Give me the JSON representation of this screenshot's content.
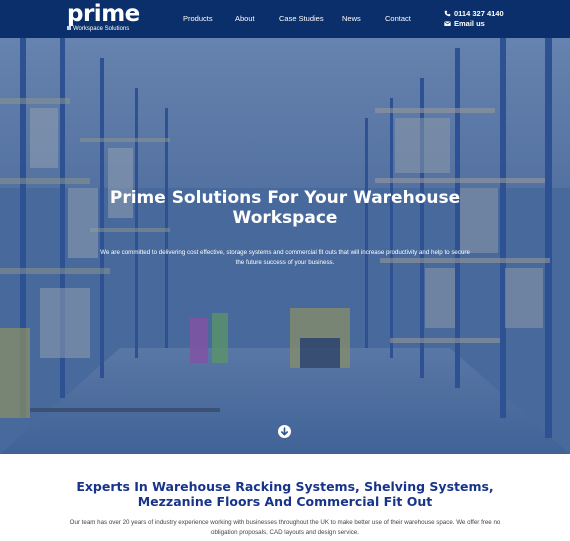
{
  "header": {
    "logo_word": "prime",
    "logo_sub": "Workspace Solutions",
    "nav": [
      "Products",
      "About",
      "Case Studies",
      "News",
      "Contact"
    ],
    "phone": "0114 327 4140",
    "email": "Email us"
  },
  "hero": {
    "title_line1": "Prime Solutions For Your Warehouse",
    "title_line2": "Workspace",
    "text": "We are committed to delivering cost effective, storage systems and commercial fit outs that will increase productivity and help to secure the future success of your business.",
    "scroll_icon": "arrow-down-circle-icon"
  },
  "section": {
    "title_line1": "Experts In Warehouse Racking Systems, Shelving Systems,",
    "title_line2": "Mezzanine Floors And Commercial Fit Out",
    "text": "Our team has over 20 years of industry experience working with businesses throughout the UK to make better use of their warehouse space. We offer free no obligation proposals, CAD layouts and design service."
  },
  "colors": {
    "header_bg": "#0b2f6b",
    "section_title": "#17348a",
    "hero_overlay": "#2f5591"
  }
}
